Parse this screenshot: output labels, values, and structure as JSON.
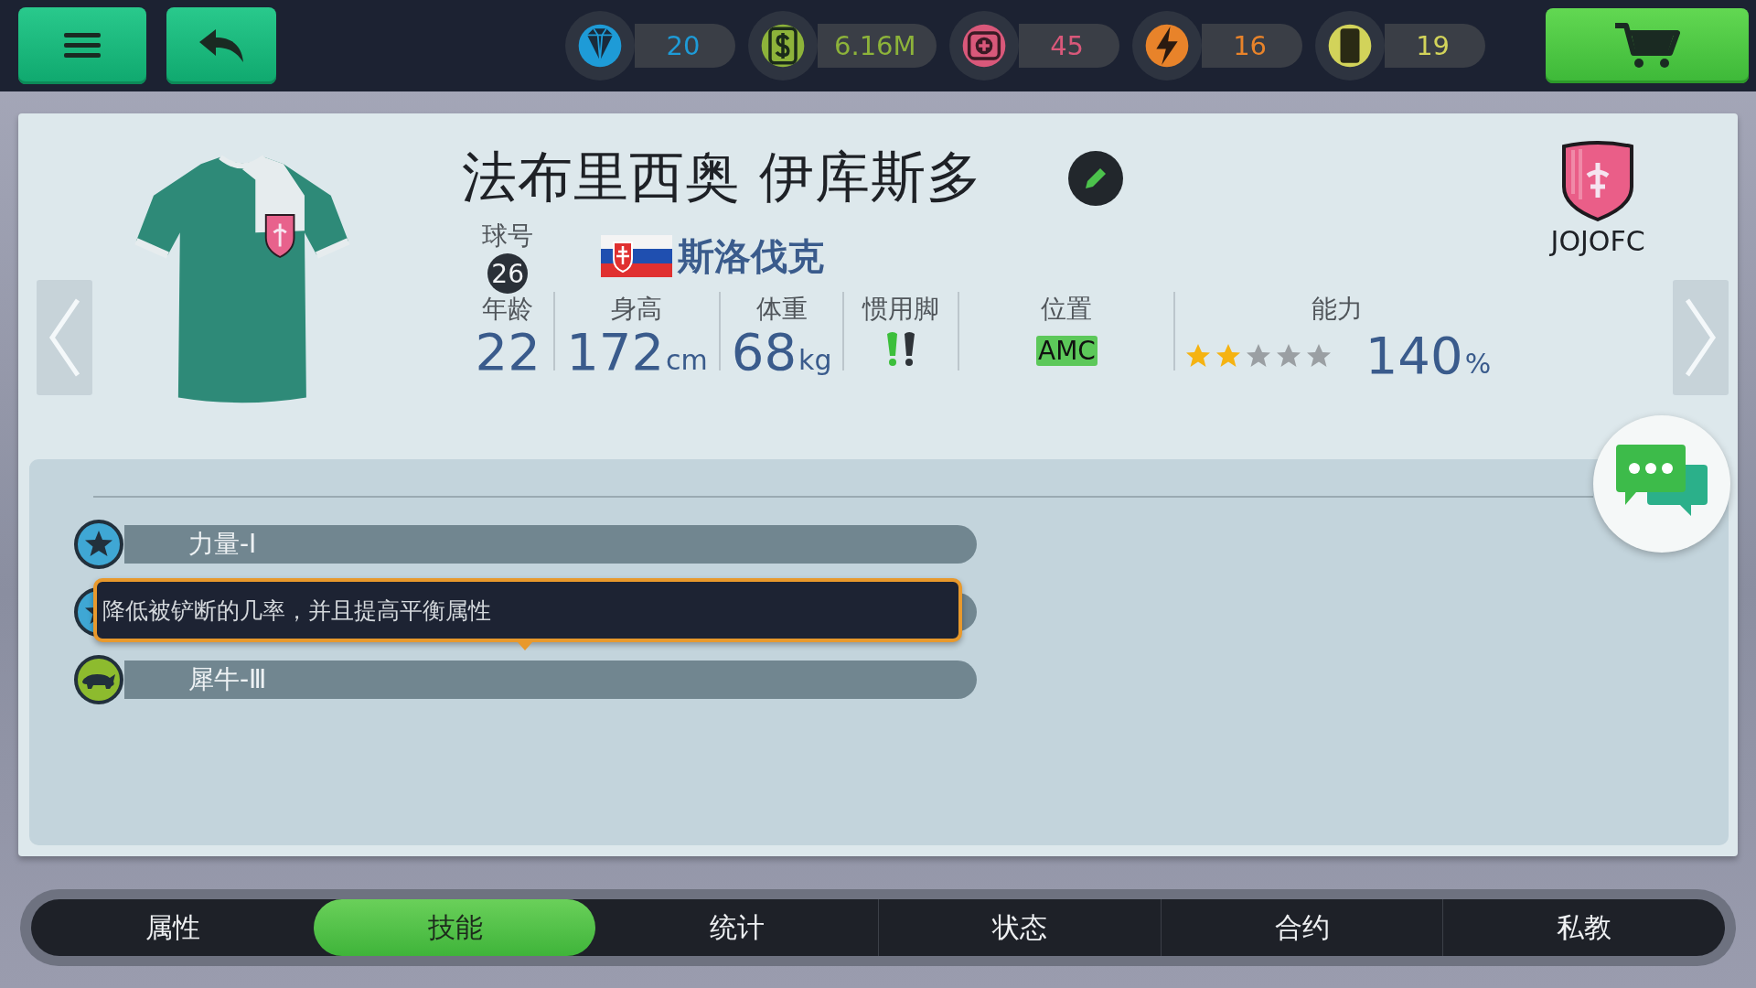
{
  "top_bar": {
    "buttons": [
      {
        "kind": "menu"
      },
      {
        "kind": "back"
      }
    ],
    "resources": [
      {
        "kind": "gem",
        "color": "#1e9bd7",
        "value": "20"
      },
      {
        "kind": "cash",
        "color": "#8db33a",
        "value": "6.16M"
      },
      {
        "kind": "medkit",
        "color": "#d9587a",
        "value": "45"
      },
      {
        "kind": "energy",
        "color": "#e8832a",
        "value": "16"
      },
      {
        "kind": "card",
        "color": "#d2d35a",
        "value": "19"
      }
    ],
    "shop_button": {
      "kind": "cart"
    }
  },
  "player": {
    "name": "法布里西奥 伊库斯多",
    "number_label": "球号",
    "number": "26",
    "country": "斯洛伐克",
    "club": "JOJOFC",
    "stats": [
      {
        "kind": "value",
        "label": "年龄",
        "value": "22"
      },
      {
        "kind": "value",
        "label": "身高",
        "value": "172",
        "unit": "cm"
      },
      {
        "kind": "value",
        "label": "体重",
        "value": "68",
        "unit": "kg"
      },
      {
        "kind": "foot",
        "label": "惯用脚",
        "left_preferred": true,
        "right_preferred": false
      },
      {
        "kind": "position",
        "label": "位置",
        "value": "AMC"
      },
      {
        "kind": "rating",
        "label": "能力",
        "stars": 2,
        "value": "140",
        "unit": "%"
      }
    ]
  },
  "skills": [
    {
      "kind": "star",
      "name": "力量-Ⅰ"
    },
    {
      "kind": "star"
    },
    {
      "kind": "rhino",
      "name": "犀牛-Ⅲ"
    }
  ],
  "tooltip": {
    "text": "降低被铲断的几率，并且提高平衡属性"
  },
  "tabs": [
    {
      "label": "属性",
      "selected": false
    },
    {
      "label": "技能",
      "selected": true
    },
    {
      "label": "统计",
      "selected": false
    },
    {
      "label": "状态",
      "selected": false
    },
    {
      "label": "合约",
      "selected": false
    },
    {
      "label": "私教",
      "selected": false
    }
  ]
}
